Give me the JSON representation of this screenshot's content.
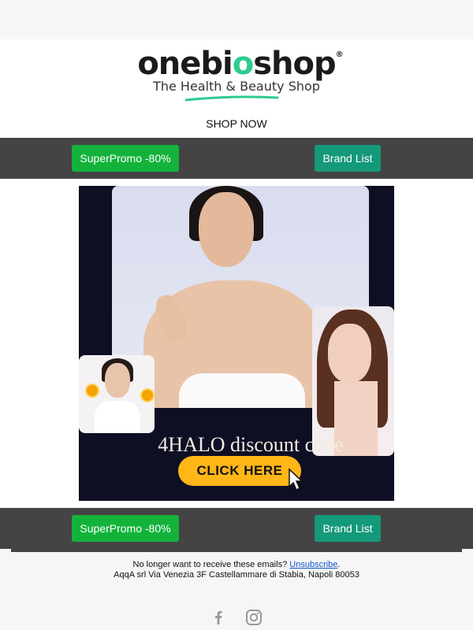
{
  "header": {
    "brand_prefix": "onebi",
    "brand_leaf": "o",
    "brand_suffix": "shop",
    "registered_mark": "®",
    "tagline": "The Health & Beauty Shop",
    "shop_now": "SHOP NOW"
  },
  "nav_top": {
    "promo_label": "SuperPromo -80%",
    "brand_label": "Brand List"
  },
  "banner": {
    "discount_text": "4HALO discount code",
    "cta_label": "CLICK HERE"
  },
  "nav_bottom": {
    "promo_label": "SuperPromo -80%",
    "brand_label": "Brand List"
  },
  "footer": {
    "unsubscribe_prefix": "No longer want to receive these emails?",
    "unsubscribe_link": "Unsubscribe",
    "unsubscribe_suffix": ".",
    "address": "AqqA srl Via Venezia 3F Castellammare di Stabia, Napoli 80053"
  },
  "social": {
    "icons": [
      "facebook-icon",
      "instagram-icon"
    ]
  },
  "colors": {
    "nav_bg": "#444444",
    "promo_button": "#13b33b",
    "brand_button": "#14997a",
    "cta_button": "#ffb617",
    "accent_green": "#2ecc8f"
  }
}
